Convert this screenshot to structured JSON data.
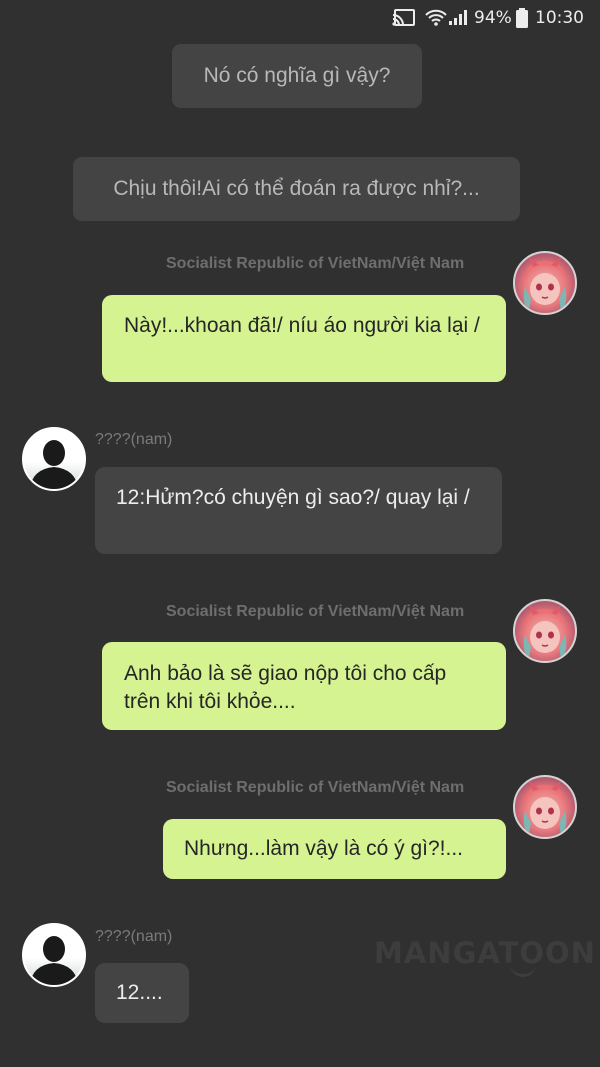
{
  "status_bar": {
    "cast_icon": "cast-icon",
    "wifi_icon": "wifi-icon",
    "signal_icon": "signal-icon",
    "battery_icon": "battery-icon",
    "battery_percent": "94%",
    "time": "10:30"
  },
  "system_messages": [
    {
      "text": "Nó có nghĩa gì vậy?"
    },
    {
      "text": "Chịu thôi!Ai có thể đoán ra được nhỉ?..."
    }
  ],
  "characters": {
    "vietnam": {
      "name": "Socialist Republic of VietNam/Việt  Nam",
      "avatar": "anime-character-avatar",
      "bubble_color": "#d5f391"
    },
    "unknown": {
      "name": "????(nam)",
      "avatar": "silhouette-avatar",
      "bubble_color": "#444444"
    }
  },
  "messages": [
    {
      "sender": "vietnam",
      "text": "Này!...khoan đã!/ níu áo người kia lại /"
    },
    {
      "sender": "unknown",
      "text": "12:Hửm?có chuyện gì sao?/ quay lại /"
    },
    {
      "sender": "vietnam",
      "text": "Anh bảo là sẽ giao nộp tôi cho cấp trên khi tôi khỏe...."
    },
    {
      "sender": "vietnam",
      "text": "Nhưng...làm vậy là có ý gì?!..."
    },
    {
      "sender": "unknown",
      "text": "12...."
    }
  ],
  "watermark": "MANGATOON"
}
